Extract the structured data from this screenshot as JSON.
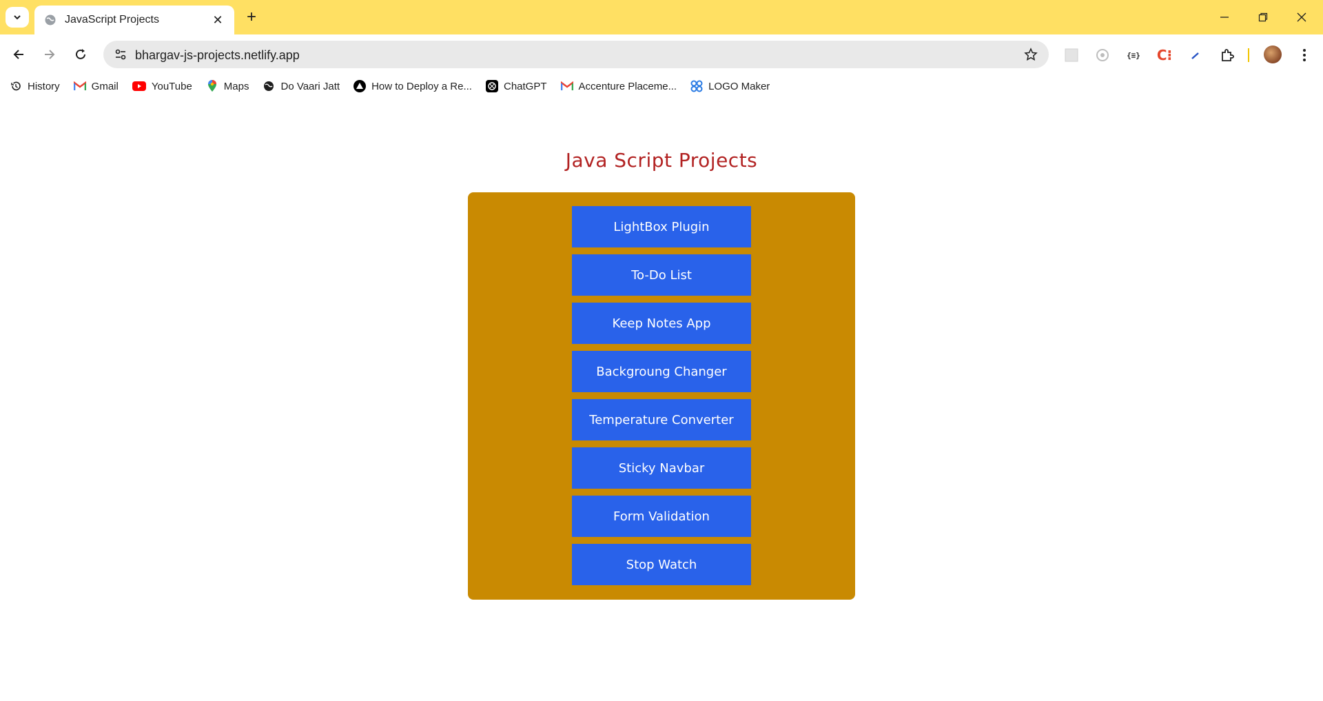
{
  "browser": {
    "tab_title": "JavaScript Projects",
    "url": "bhargav-js-projects.netlify.app"
  },
  "bookmarks": [
    {
      "label": "History",
      "icon": "history-icon"
    },
    {
      "label": "Gmail",
      "icon": "gmail-icon"
    },
    {
      "label": "YouTube",
      "icon": "youtube-icon"
    },
    {
      "label": "Maps",
      "icon": "maps-icon"
    },
    {
      "label": "Do Vaari Jatt",
      "icon": "globe-icon"
    },
    {
      "label": "How to Deploy a Re...",
      "icon": "vercel-icon"
    },
    {
      "label": "ChatGPT",
      "icon": "chatgpt-icon"
    },
    {
      "label": "Accenture Placeme...",
      "icon": "gmail-icon"
    },
    {
      "label": "LOGO Maker",
      "icon": "logo-maker-icon"
    }
  ],
  "page": {
    "title": "Java Script Projects",
    "projects": [
      "LightBox Plugin",
      "To-Do List",
      "Keep Notes App",
      "Backgroung Changer",
      "Temperature Converter",
      "Sticky Navbar",
      "Form Validation",
      "Stop Watch"
    ]
  },
  "colors": {
    "tabstrip": "#ffe063",
    "panel": "#c98a02",
    "button": "#2962ea",
    "title": "#b22222"
  }
}
